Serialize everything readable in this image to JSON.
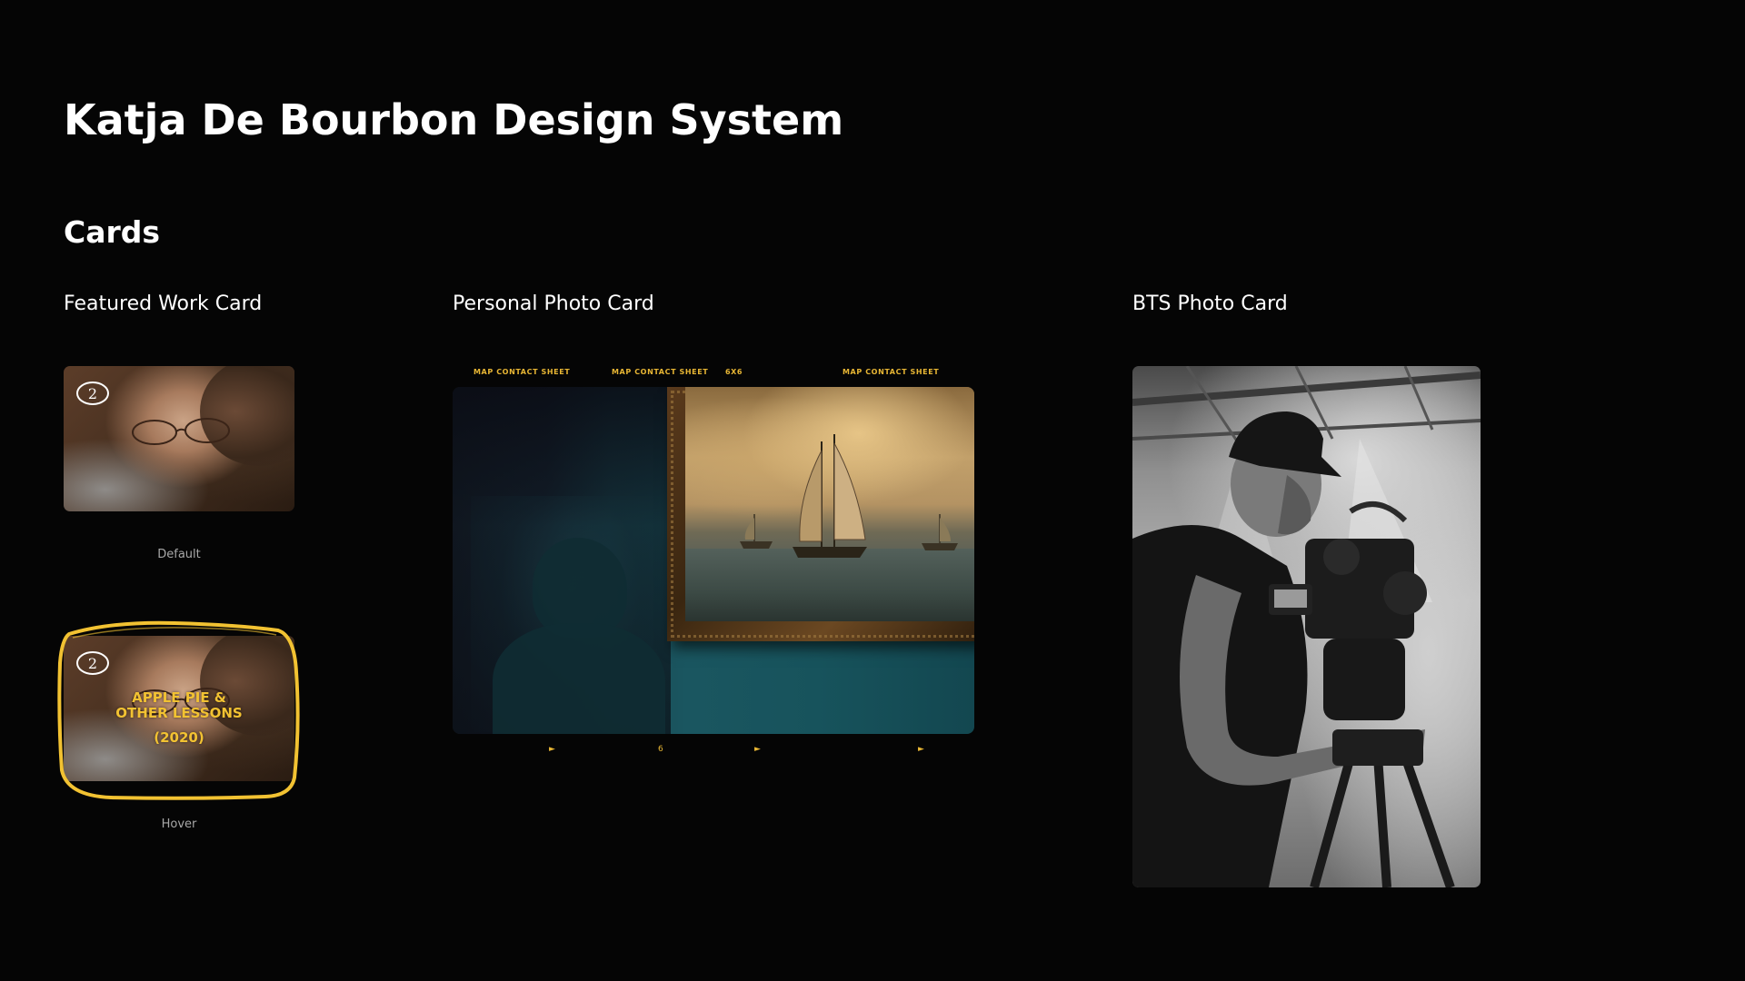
{
  "page": {
    "title": "Katja De Bourbon Design System",
    "section": "Cards"
  },
  "columns": {
    "featured": "Featured Work Card",
    "personal": "Personal Photo Card",
    "bts": "BTS Photo Card"
  },
  "featured_card": {
    "default_label": "Default",
    "hover_label": "Hover",
    "badge_number": "2",
    "hover_title_line1": "APPLE PIE &",
    "hover_title_line2": "OTHER LESSONS",
    "hover_year": "(2020)"
  },
  "personal_card": {
    "top_labels": [
      "MAP CONTACT SHEET",
      "MAP CONTACT SHEET",
      "6X6",
      "MAP CONTACT SHEET"
    ],
    "bottom_marks": [
      "►",
      "6",
      "►",
      "►"
    ]
  },
  "colors": {
    "background": "#050505",
    "accent_yellow": "#f2c232",
    "state_label": "#a8a8a8"
  }
}
